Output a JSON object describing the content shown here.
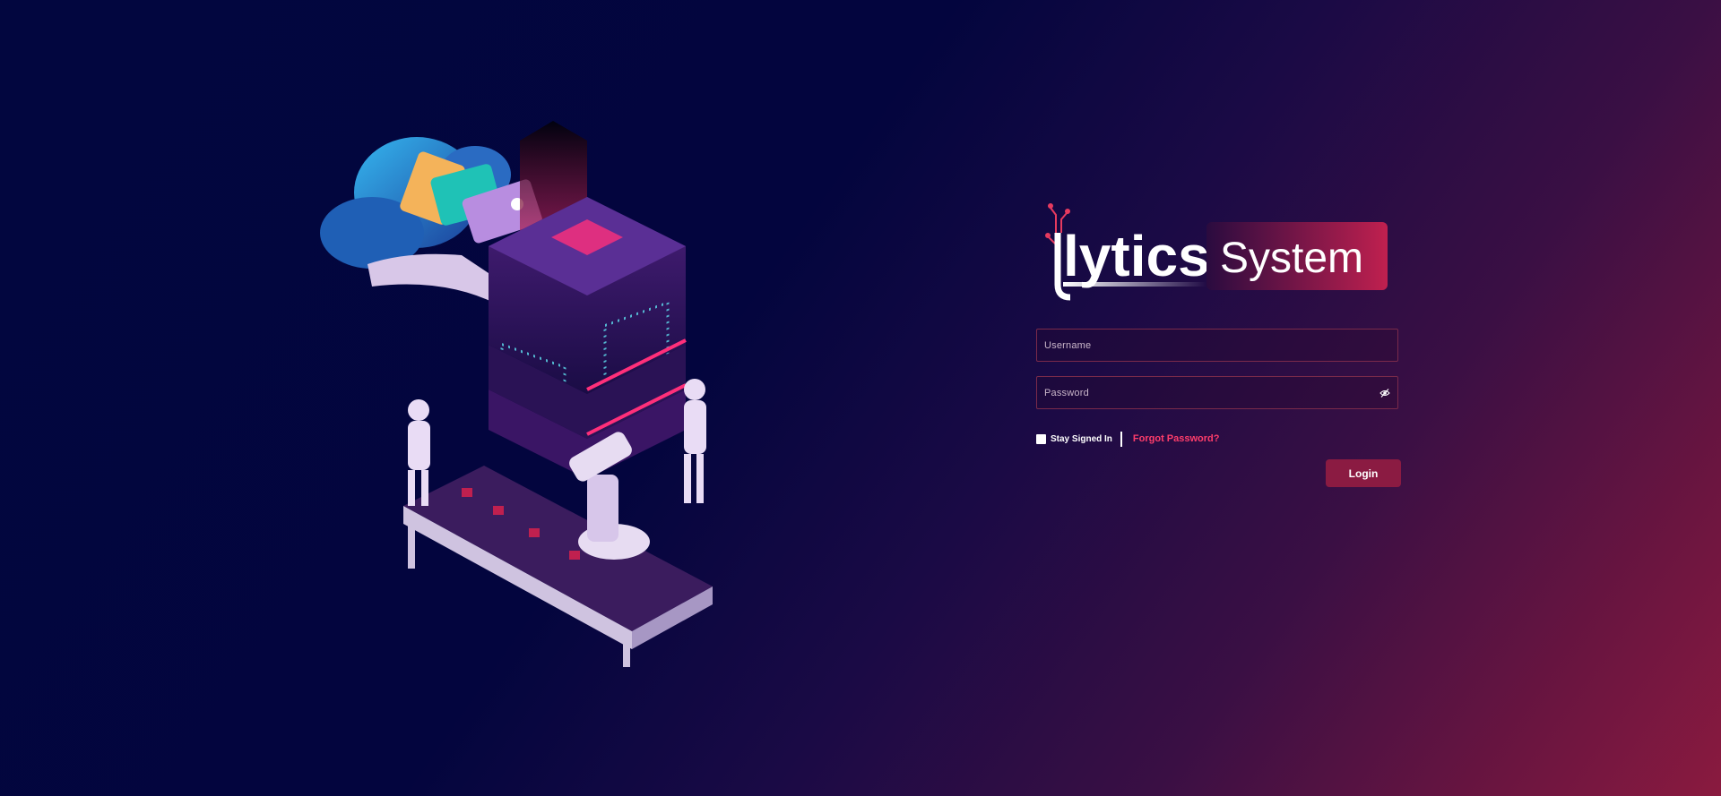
{
  "brand": {
    "logo_text": "lytics",
    "logo_badge": "System"
  },
  "form": {
    "username_placeholder": "Username",
    "password_placeholder": "Password",
    "remember_label": "Stay Signed In",
    "forgot_link": "Forgot Password?",
    "login_button": "Login"
  },
  "colors": {
    "accent": "#ff3d6b",
    "button": "#8b1b42",
    "background_dark": "#02063f",
    "background_light": "#8a1a3f"
  },
  "icons": {
    "password_toggle": "eye-slash-icon"
  }
}
